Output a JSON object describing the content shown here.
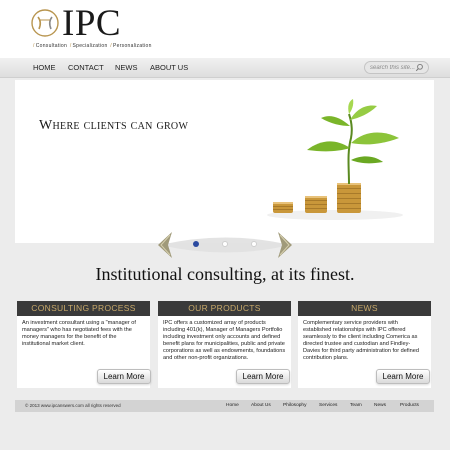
{
  "brand": {
    "name": "IPC",
    "tagline": [
      "Consultation",
      "Specialization",
      "Personalization"
    ],
    "accent_color": "#b8954f"
  },
  "nav": {
    "items": [
      "HOME",
      "CONTACT",
      "NEWS",
      "ABOUT US"
    ],
    "search_placeholder": "search this site...",
    "search_icon": "magnifier-icon"
  },
  "banner": {
    "text": "Where clients can grow",
    "image": "sprouting-coins-illustration",
    "slider": {
      "slide_count": 3,
      "active_index": 0,
      "arrow_left": "chevron-left-icon",
      "arrow_right": "chevron-right-icon"
    }
  },
  "headline": "Institutional consulting, at its finest.",
  "columns": [
    {
      "title": "CONSULTING PROCESS",
      "body": "An investment consultant using a \"manager of managers\" who has negotiated fees with the money managers for the benefit of the institutional market client.",
      "button": "Learn More"
    },
    {
      "title": "OUR PRODUCTS",
      "body": "IPC offers a customized array of products including 401(k), Manager of Managers Portfolio including investment only accounts and defined benefit plans for municipalities, public and private corporations as well as endowments, foundations and other non-profit organizations.",
      "button": "Learn More"
    },
    {
      "title": "NEWS",
      "body": "Complementary service providers with established relationships with IPC offered seamlessly to the client including Comerica as directed trustee and custodian and Findley-Davies for third party administration for defined contribution plans.",
      "button": "Learn More"
    }
  ],
  "footer": {
    "copyright": "© 2013 www.ipcanswers.com all rights reserved",
    "links": [
      "Home",
      "About Us",
      "Philosophy",
      "Services",
      "Team",
      "News",
      "Products"
    ]
  },
  "colors": {
    "column_header_bg": "#3a3a3a",
    "column_header_text": "#c8a96a",
    "active_dot": "#2b4aa0"
  }
}
